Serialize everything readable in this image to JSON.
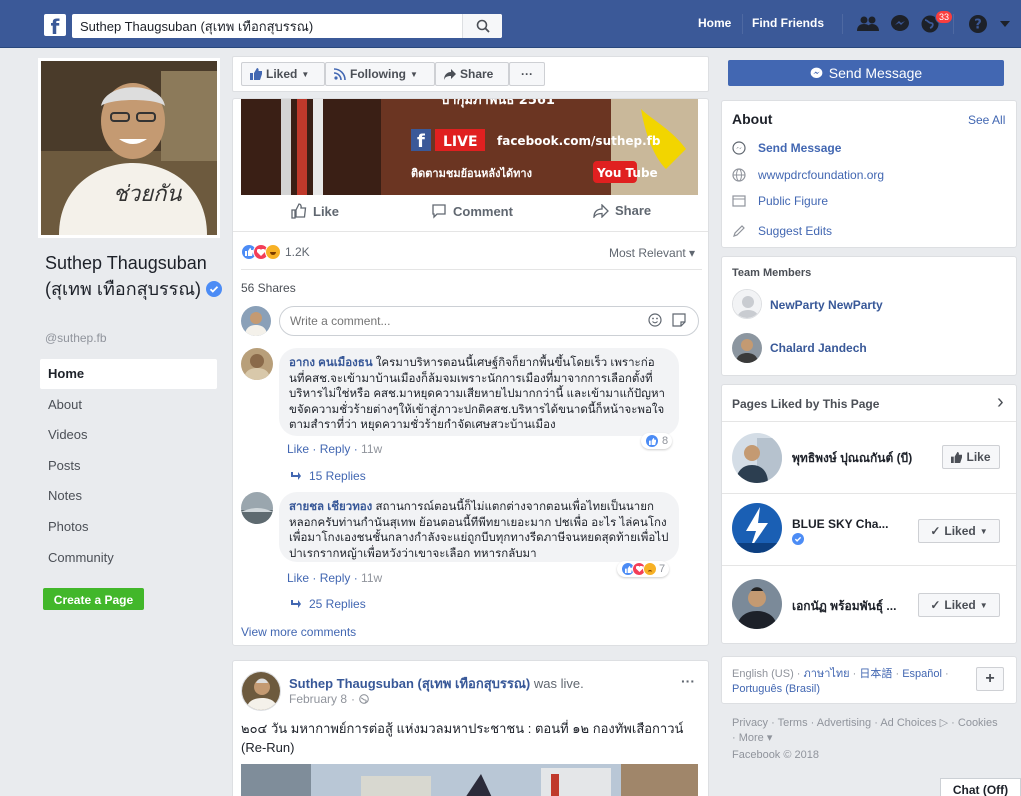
{
  "header": {
    "search_value": "Suthep Thaugsuban (สุเทพ เทือกสุบรรณ)",
    "nav_home": "Home",
    "nav_find_friends": "Find Friends",
    "notifications_count": "33"
  },
  "profile": {
    "name": "Suthep Thaugsuban (สุเทพ เทือกสุบรรณ)",
    "handle": "@suthep.fb",
    "pic_caption": "ช่วยกัน"
  },
  "left_nav": [
    "Home",
    "About",
    "Videos",
    "Posts",
    "Notes",
    "Photos",
    "Community"
  ],
  "create_page_label": "Create a Page",
  "action_bar": {
    "liked": "Liked",
    "following": "Following",
    "share": "Share",
    "more": "···"
  },
  "post1": {
    "video": {
      "live_label": "LIVE",
      "url_text": "facebook.com/suthep.fb",
      "subtitle": "ติดตามชมย้อนหลังได้ทาง",
      "youtube": "You Tube",
      "top_text": "ปากุมภาพันธ์ 2561"
    },
    "actions": {
      "like": "Like",
      "comment": "Comment",
      "share": "Share"
    },
    "reaction_count": "1.2K",
    "most_relevant": "Most Relevant ▾",
    "shares": "56 Shares",
    "comment_placeholder": "Write a comment...",
    "comments": [
      {
        "name": "อากง คนเมืองธน",
        "text": "ใครมาบริหารตอนนี้เศษฐ์กิจก็ยากพื้นขึ้นโดยเร็ว เพราะก่อนที่คสช.จะเข้ามาบ้านเมืองก็ล้มจมเพราะนักการเมืองที่มาจากการเลือกตั้งที่บริหารไม่ใช่หรือ คสช.มาหยุดความเสียหายไปมากกว่านี้ และเข้ามาแก้ปัญหาขจัดความชั่วร้ายต่างๆให้เข้าสู่ภาวะปกติคสช.บริหารได้ขนาดนี้ก็หน้าจะพอใจ ตามสำราที่ว่า หยุดความชั่วร้ายกำจัดเศษสวะบ้านเมือง",
        "like": "Like",
        "reply": "Reply",
        "time": "11w",
        "reactions": "8",
        "replies": "15 Replies"
      },
      {
        "name": "สายชล เชียวทอง",
        "text": "สถานการณ์ตอนนี้ก็ไม่แตกต่างจากตอนเพื่อไทยเป็นนายกหลอกครับท่านกำนันสุเทพ ย้อนตอนนี้ทีพีทยาเยอะมาก ปชเพื่อ อะไร ไล่คนโกงเพื่อมาโกงเองชนชั้นกลางกำลังจะแย่ถูกบีบทุกทางรีดภาษีจนหยดสุดท้ายเพื่อไปปาเรกรากหญ้าเพื่อหวังว่าเขาจะเลือก ทหารกลับมา",
        "like": "Like",
        "reply": "Reply",
        "time": "11w",
        "reactions": "7",
        "replies": "25 Replies"
      }
    ],
    "view_more": "View more comments"
  },
  "post2": {
    "author": "Suthep Thaugsuban (สุเทพ เทือกสุบรรณ)",
    "was_live": "was live.",
    "date": "February 8",
    "dots": "···",
    "text": "๒๐๔ วัน มหากาพย์การต่อสู้ แห่งมวลมหาประชาชน : ตอนที่ ๑๒ กองทัพเสือกาวน์ (Re-Run)"
  },
  "right": {
    "send_message": "Send Message",
    "about": {
      "title": "About",
      "see_all": "See All",
      "send_message": "Send Message",
      "website": "wwwpdrcfoundation.org",
      "category": "Public Figure",
      "suggest": "Suggest Edits"
    },
    "team": {
      "title": "Team Members",
      "members": [
        "NewParty NewParty",
        "Chalard Jandech"
      ]
    },
    "liked_pages": {
      "title": "Pages Liked by This Page",
      "chevron": "›",
      "pages": [
        {
          "name": "พุทธิพงษ์ ปุณณกันต์ (บี)",
          "button": "Like"
        },
        {
          "name": "BLUE SKY Cha...",
          "button": "Liked"
        },
        {
          "name": "เอกนัฏ พร้อมพันธุ์ ...",
          "button": "Liked"
        }
      ]
    },
    "languages": {
      "current": "English (US)",
      "options": [
        "ภาษาไทย",
        "日本語",
        "Español",
        "Português (Brasil)"
      ],
      "add": "+"
    },
    "footer_links": "Privacy · Terms · Advertising · Ad Choices ▷ · Cookies · More ▾",
    "copyright": "Facebook © 2018"
  },
  "chat": "Chat (Off)",
  "colors": {
    "brand": "#3b5998",
    "link": "#4267b2",
    "green": "#42b72a"
  }
}
